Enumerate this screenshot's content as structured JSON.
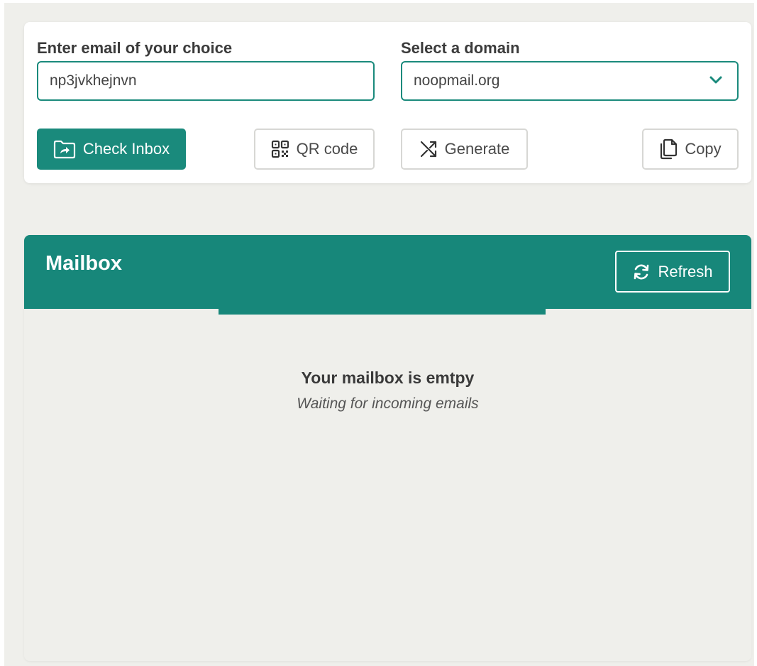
{
  "form": {
    "email_label": "Enter email of your choice",
    "email_value": "np3jvkhejnvn",
    "domain_label": "Select a domain",
    "domain_value": "noopmail.org"
  },
  "actions": {
    "check_inbox": "Check Inbox",
    "qr_code": "QR code",
    "generate": "Generate",
    "copy": "Copy"
  },
  "mailbox": {
    "title": "Mailbox",
    "refresh": "Refresh",
    "empty_title": "Your mailbox is emtpy",
    "empty_subtitle": "Waiting for incoming emails"
  },
  "icons": {
    "check_inbox": "folder-share-icon",
    "qr_code": "qr-code-icon",
    "generate": "shuffle-icon",
    "copy": "copy-icon",
    "refresh": "refresh-icon",
    "domain_dropdown": "chevron-down-icon"
  },
  "colors": {
    "accent": "#17877a",
    "background": "#efefeb",
    "card": "#ffffff"
  }
}
